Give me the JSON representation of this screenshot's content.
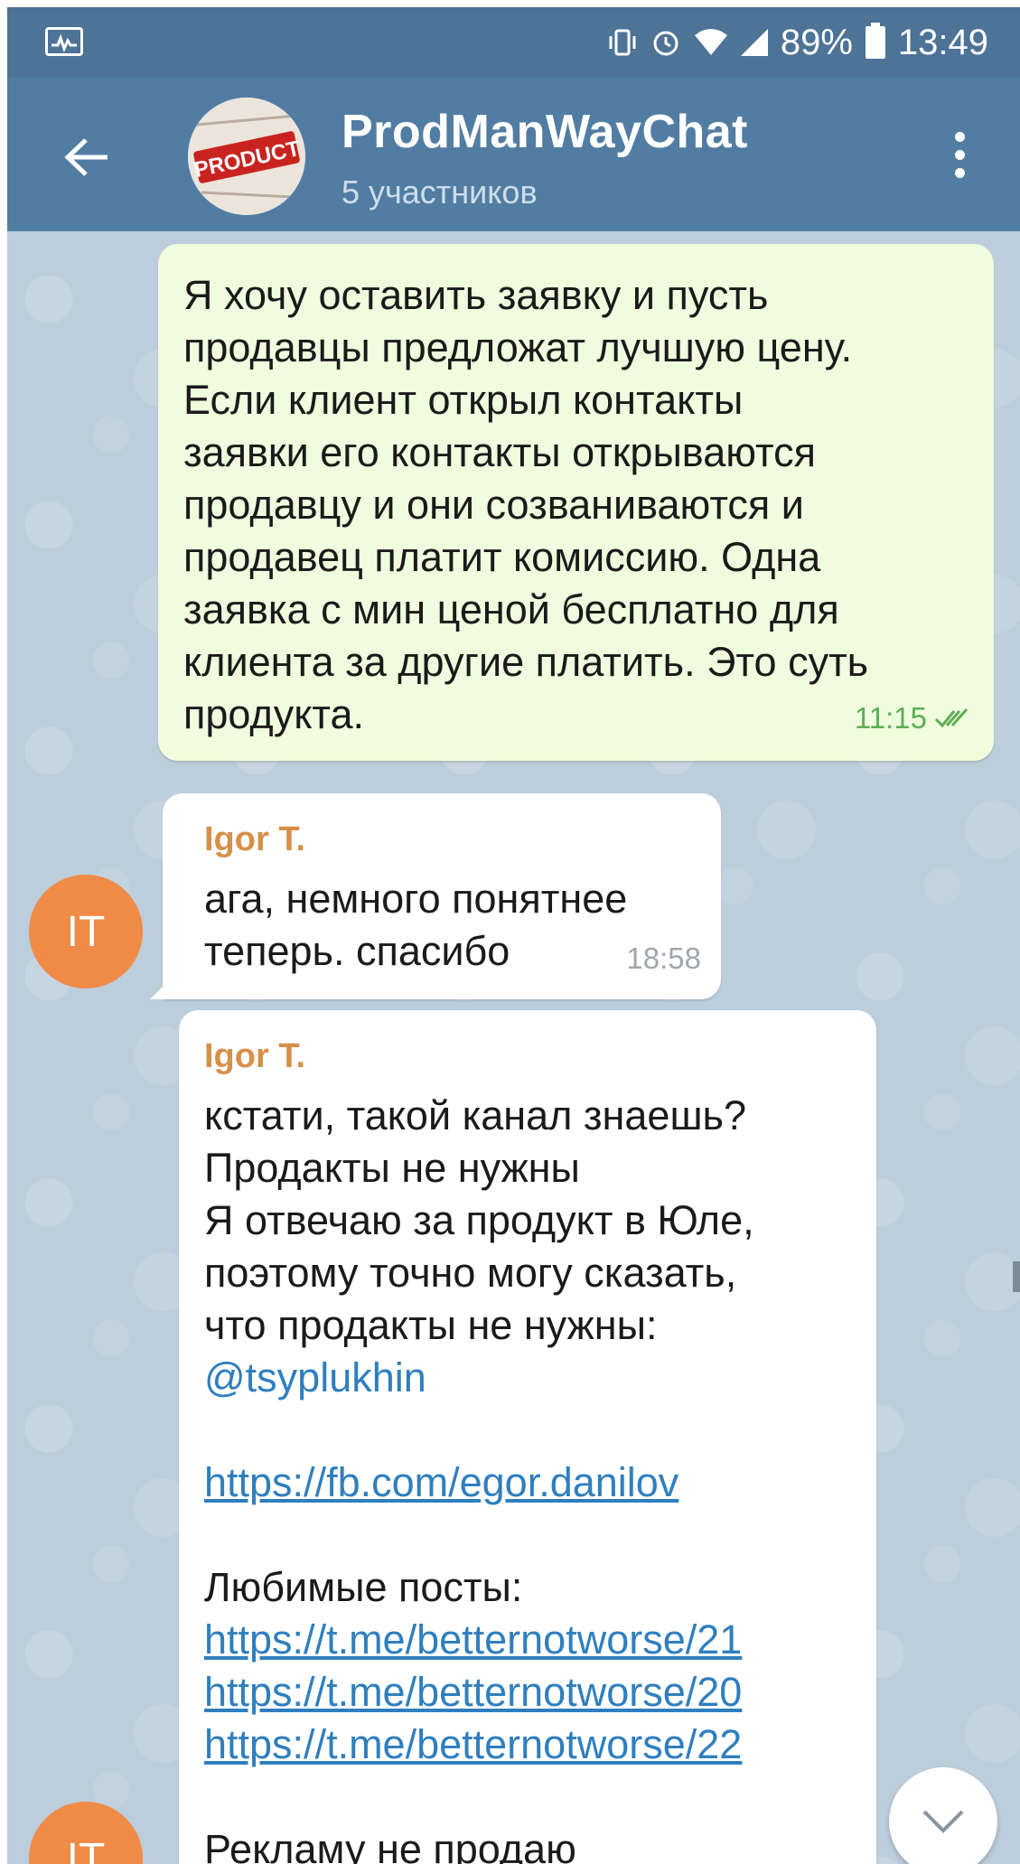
{
  "status_bar": {
    "battery_percent": "89%",
    "time": "13:49",
    "icons": [
      "activity-icon",
      "vibrate-icon",
      "alarm-icon",
      "wifi-icon",
      "signal-icon",
      "battery-icon"
    ]
  },
  "header": {
    "title": "ProdManWayChat",
    "subtitle": "5 участников",
    "avatar_text": "PRODUCT",
    "accent_color": "#527da3"
  },
  "messages": [
    {
      "direction": "outgoing",
      "text": "Я хочу оставить заявку и пусть\nпродавцы предложат лучшую цену.\nЕсли клиент открыл контакты\nзаявки его контакты открываются\nпродавцу и они созваниваются и\nпродавец платит комиссию. Одна\nзаявка с мин ценой бесплатно для\nклиента за другие платить. Это суть\nпродукта.",
      "time": "11:15"
    },
    {
      "direction": "incoming",
      "sender": "Igor T.",
      "text": "ага, немного понятнее\nтеперь. спасибо",
      "time": "18:58"
    },
    {
      "direction": "incoming",
      "sender": "Igor T.",
      "lines_before_mention": "кстати, такой канал знаешь?\nПродакты не нужны\nЯ отвечаю за продукт в Юле,\nпоэтому точно могу сказать,\nчто продакты не нужны:",
      "mention": "@tsyplukhin",
      "fb_link": "https://fb.com/egor.danilov",
      "favorites_label": "Любимые посты:",
      "links": [
        "https://t.me/betternotworse/21",
        "https://t.me/betternotworse/20",
        "https://t.me/betternotworse/22"
      ],
      "last_line": "Рекламу не продаю"
    }
  ],
  "avatars": {
    "initials": "IT",
    "color": "#f08b47"
  }
}
